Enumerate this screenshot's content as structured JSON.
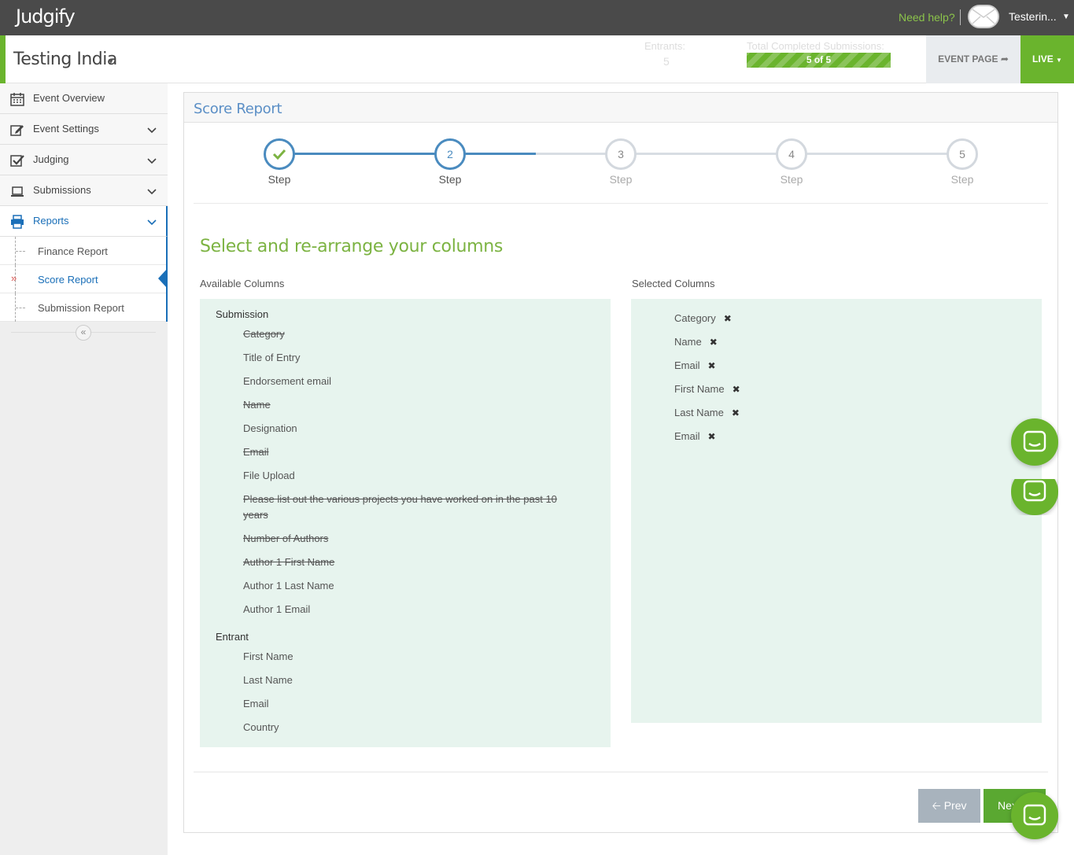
{
  "topbar": {
    "logo": "Judgify",
    "need_help": "Need help?",
    "username": "Testerin..."
  },
  "event": {
    "title": "Testing India",
    "entrants_label": "Entrants:",
    "entrants_value": "5",
    "total_label": "Total Completed Submissions:",
    "progress_text": "5 of 5",
    "progress_fraction": 1.0,
    "event_page_label": "EVENT PAGE",
    "live_label": "LIVE"
  },
  "sidebar": {
    "items": [
      {
        "label": "Event Overview",
        "icon": "calendar-icon"
      },
      {
        "label": "Event Settings",
        "icon": "edit-icon"
      },
      {
        "label": "Judging",
        "icon": "checkbox-icon"
      },
      {
        "label": "Submissions",
        "icon": "laptop-icon"
      },
      {
        "label": "Reports",
        "icon": "printer-icon"
      }
    ],
    "sub_items": [
      {
        "label": "Finance Report"
      },
      {
        "label": "Score Report"
      },
      {
        "label": "Submission Report"
      }
    ],
    "collapse": "«"
  },
  "panel": {
    "title": "Score Report",
    "steps": [
      {
        "number": "1",
        "label": "Step",
        "state": "done"
      },
      {
        "number": "2",
        "label": "Step",
        "state": "current"
      },
      {
        "number": "3",
        "label": "Step",
        "state": "todo"
      },
      {
        "number": "4",
        "label": "Step",
        "state": "todo"
      },
      {
        "number": "5",
        "label": "Step",
        "state": "todo"
      }
    ],
    "section_title": "Select and re-arrange your columns",
    "available_label": "Available Columns",
    "selected_label": "Selected Columns",
    "groups": [
      {
        "name": "Submission",
        "columns": [
          {
            "label": "Category",
            "used": true
          },
          {
            "label": "Title of Entry",
            "used": false
          },
          {
            "label": "Endorsement email",
            "used": false
          },
          {
            "label": "Name",
            "used": true
          },
          {
            "label": "Designation",
            "used": false
          },
          {
            "label": "Email",
            "used": true
          },
          {
            "label": "File Upload",
            "used": false
          },
          {
            "label": "Please list out the various projects you have worked on in the past 10 years",
            "used": true
          },
          {
            "label": "Number of Authors",
            "used": true
          },
          {
            "label": "Author 1 First Name",
            "used": true
          },
          {
            "label": "Author 1 Last Name",
            "used": false
          },
          {
            "label": "Author 1 Email",
            "used": false
          }
        ]
      },
      {
        "name": "Entrant",
        "columns": [
          {
            "label": "First Name",
            "used": false
          },
          {
            "label": "Last Name",
            "used": false
          },
          {
            "label": "Email",
            "used": false
          },
          {
            "label": "Country",
            "used": false
          }
        ]
      }
    ],
    "selected": [
      "Category",
      "Name",
      "Email",
      "First Name",
      "Last Name",
      "Email"
    ],
    "prev_label": "Prev",
    "next_label": "Nex"
  },
  "colors": {
    "brand_green": "#6ab42d",
    "link_blue": "#1a6fb8",
    "panel_bg": "#e7f4ee",
    "step_blue": "#4a8bbf"
  }
}
